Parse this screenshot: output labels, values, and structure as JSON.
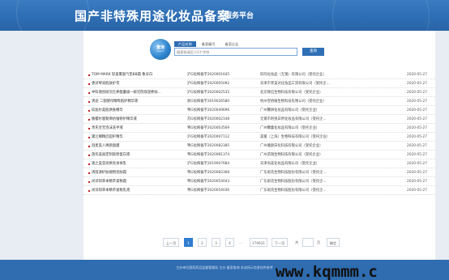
{
  "header": {
    "title": "国产非特殊用途化妆品备案",
    "subtitle": "服务平台"
  },
  "search": {
    "logo_text": "查询",
    "logo_sub": "Search",
    "tabs": [
      {
        "label": "产品名称",
        "active": true
      },
      {
        "label": "备案编号",
        "active": false
      },
      {
        "label": "备案企业",
        "active": false
      }
    ],
    "placeholder": "搜索前请至少2个字符",
    "button_label": "查询"
  },
  "records": [
    {
      "name": "TOM MARK 轻柔雾面气垫BB霜 象牙白",
      "reg": "沪G妆网备字2020001645",
      "company": "科玛化妆品（无锡）有限公司（受托企业）",
      "date": "2020-05-27"
    },
    {
      "name": "香诗琴采肌肤护膏",
      "reg": "沪G妆网备字2020005092",
      "company": "天津市李美达化妆品工贸有限公司（受托企...",
      "date": "2020-05-27"
    },
    {
      "name": "中科翡创研究在养能量级一研究院保湿养肤...",
      "reg": "沪G妆网备字2020002535",
      "company": "北京致信生物科技有限公司（受托企业）",
      "date": "2020-05-27"
    },
    {
      "name": "清迹 二裂酵母精粹肌护精华液",
      "reg": "浙G妆网备字2019026580",
      "company": "杭州宣梧植生物科技有限公司（受托企业）",
      "date": "2020-05-27"
    },
    {
      "name": "玖逅尔美肌焕肤精华",
      "reg": "粤G妆网备字2020049696",
      "company": "广州馨妍化妆品有限公司（受托企业）",
      "date": "2020-05-27"
    },
    {
      "name": "敬樱尔富勒烯抗皱修护精华液",
      "reg": "苏G妆网备字2020002148",
      "company": "无锡市利悦日用化妆品有限公司（受托企...",
      "date": "2020-05-27"
    },
    {
      "name": "贵氏宝宝泡沫洗手液",
      "reg": "粤G妆网备字2020003569",
      "company": "广州馨蕾化妆品有限公司（受托企业）",
      "date": "2020-05-27"
    },
    {
      "name": "黛兰娜精启超护精华",
      "reg": "沪G妆网备字2020007112",
      "company": "美蜜（上海）生物科技有限公司（受托企业）",
      "date": "2020-05-27"
    },
    {
      "name": "羽麦美人焕颜面膜",
      "reg": "粤G妆网备字2020082385",
      "company": "广州雅颜日化科技有限公司（受托企业）",
      "date": "2020-05-27"
    },
    {
      "name": "茵优美丽定制胶原蛋白液",
      "reg": "粤G妆网备字2020081374",
      "company": "广州诺瑞生物科技有限公司（受托企业）",
      "date": "2020-05-27"
    },
    {
      "name": "速之美莹润焕亮身体乳",
      "reg": "沪G妆网备字2019007684",
      "company": "天津尚美化妆品有限公司（受托企业）",
      "date": "2020-05-27"
    },
    {
      "name": "清茵源护肤植物亮肤霜",
      "reg": "粤G妆网备字2020082368",
      "company": "广东斑氏生物科技股份有限公司（受托企...",
      "date": "2020-05-27"
    },
    {
      "name": "尚诗琪草本精萃紧致霜",
      "reg": "粤G妆网备字2020054043",
      "company": "广东斑氏生物科技股份有限公司（受托企...",
      "date": "2020-05-27"
    },
    {
      "name": "尚诗琪草本精萃紧致乳液",
      "reg": "粤G妆网备字2020054036",
      "company": "广东斑氏生物科技股份有限公司（受托企...",
      "date": "2020-05-27"
    }
  ],
  "pagination": {
    "prev": "上一页",
    "pages": [
      "1",
      "2",
      "3",
      "4"
    ],
    "ellipsis": "...",
    "last": "170631",
    "next": "下一页",
    "total_label": "共",
    "goto_suffix": "页",
    "goto_button": "确定"
  },
  "footer": {
    "text": "主办单位国家药品监督管理局 主办 备案查询 本站所示信息仅供参考"
  },
  "watermark": "www.kqmmm.c",
  "colors": {
    "header_blue": "#2d6db3",
    "footer_blue": "#2f6cb0",
    "bullet_red": "#c8161d",
    "page_active": "#2f7cd0"
  }
}
